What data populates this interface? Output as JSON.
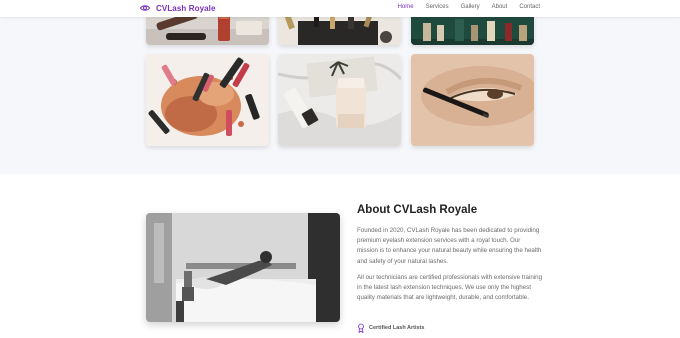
{
  "brand": {
    "name": "CVLash Royale",
    "icon": "eye-icon",
    "color": "#7b2fbf"
  },
  "nav": {
    "links": [
      {
        "label": "Home",
        "active": true
      },
      {
        "label": "Services",
        "active": false
      },
      {
        "label": "Gallery",
        "active": false
      },
      {
        "label": "About",
        "active": false
      },
      {
        "label": "Contact",
        "active": false
      }
    ]
  },
  "gallery": {
    "images": [
      {
        "subject": "makeup-brushes-and-lipstick"
      },
      {
        "subject": "makeup-brushes-in-cup"
      },
      {
        "subject": "cosmetic-bottles-on-shelf"
      },
      {
        "subject": "crushed-eyeshadow-and-lipsticks"
      },
      {
        "subject": "skincare-bottles-on-fabric"
      },
      {
        "subject": "eye-with-eyeliner"
      }
    ]
  },
  "about": {
    "title": "About CVLash Royale",
    "paragraph1": "Founded in 2020, CVLash Royale has been dedicated to providing premium eyelash extension services with a royal touch. Our mission is to enhance your natural beauty while ensuring the health and safety of your natural lashes.",
    "paragraph2": "All our technicians are certified professionals with extensive training in the latest lash extension techniques. We use only the highest quality materials that are lightweight, durable, and comfortable.",
    "feature": {
      "label": "Certified Lash Artists",
      "icon": "award-icon"
    }
  },
  "colors": {
    "accent": "#7b2fbf",
    "section_bg": "#f6f7fb",
    "text": "#6b6b6b"
  }
}
